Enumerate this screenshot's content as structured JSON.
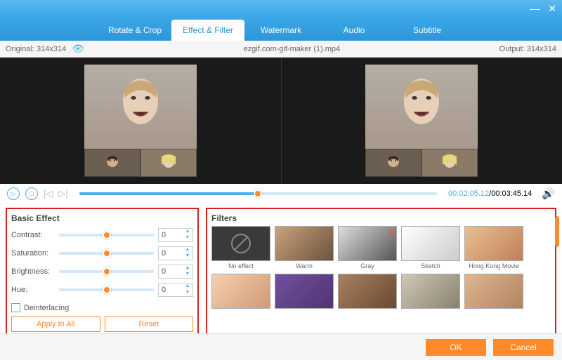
{
  "titlebar": {
    "min": "—",
    "close": "✕"
  },
  "tabs": [
    "Rotate & Crop",
    "Effect & Filter",
    "Watermark",
    "Audio",
    "Subtitle"
  ],
  "active_tab": 1,
  "info": {
    "original_label": "Original: 314x314",
    "filename": "ezgif.com-gif-maker (1).mp4",
    "output_label": "Output: 314x314"
  },
  "playback": {
    "current": "00:02:05.12",
    "total": "00:03:45.14",
    "progress_pct": 50
  },
  "basic": {
    "title": "Basic Effect",
    "rows": [
      {
        "label": "Contrast:",
        "value": "0",
        "pct": 50
      },
      {
        "label": "Saturation:",
        "value": "0",
        "pct": 50
      },
      {
        "label": "Brightness:",
        "value": "0",
        "pct": 50
      },
      {
        "label": "Hue:",
        "value": "0",
        "pct": 50
      }
    ],
    "deinterlacing": "Deinterlacing",
    "apply": "Apply to All",
    "reset": "Reset"
  },
  "filters": {
    "title": "Filters",
    "items": [
      "No effect",
      "Warm",
      "Gray",
      "Sketch",
      "Hong Kong Movie",
      "",
      "",
      "",
      "",
      ""
    ],
    "starred": 2
  },
  "footer": {
    "ok": "OK",
    "cancel": "Cancel"
  }
}
